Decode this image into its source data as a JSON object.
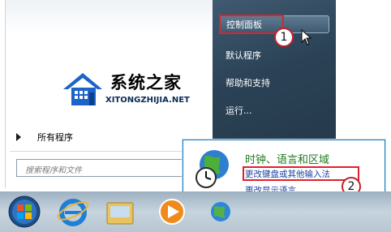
{
  "start_menu": {
    "watermark": {
      "brand": "系统之家",
      "site": "XITONGZHIJIA.NET"
    },
    "all_programs": "所有程序",
    "search_placeholder": "搜索程序和文件",
    "right_items": [
      "控制面板",
      "默认程序",
      "帮助和支持",
      "运行..."
    ]
  },
  "annotations": {
    "step1": "1",
    "step2": "2"
  },
  "popup": {
    "title": "时钟、语言和区域",
    "link1": "更改键盘或其他输入法",
    "link2": "更改显示语言"
  },
  "taskbar": {
    "icons": [
      "start-orb-icon",
      "internet-explorer-icon",
      "windows-explorer-icon",
      "media-player-icon",
      "network-icon"
    ]
  },
  "colors": {
    "highlight_red": "#e0212b",
    "link_blue": "#1a3e9e",
    "category_green": "#1e7a1e"
  }
}
